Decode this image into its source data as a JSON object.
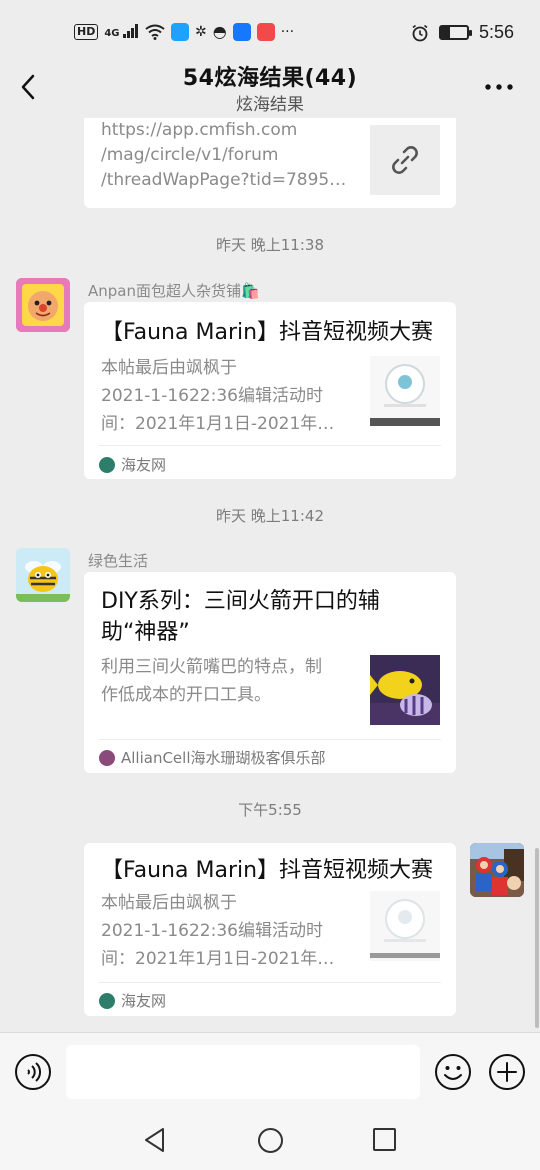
{
  "status_bar": {
    "hd": "HD",
    "signal": "4G",
    "time": "5:56",
    "battery_level": 0.35,
    "icons": [
      "hd-icon",
      "signal-icon",
      "wifi-icon",
      "app-icon",
      "weibo-icon",
      "qq-icon",
      "alipay-icon",
      "app-icon",
      "more-notifications-icon",
      "alarm-icon",
      "battery-icon"
    ]
  },
  "header": {
    "title": "54炫海结果(44)",
    "subtitle": "炫海结果",
    "back_icon": "chevron-left-icon",
    "more_icon": "more-horizontal-icon"
  },
  "messages": [
    {
      "type": "link-card-partial",
      "url_lines": [
        "https://app.cmfish.com",
        "/mag/circle/v1/forum",
        "/threadWapPage?tid=7895…"
      ],
      "thumb_icon": "link-icon"
    },
    {
      "timestamp": "昨天 晚上11:38",
      "sender": "Anpan面包超人杂货铺🛍️",
      "title": "【Fauna Marin】抖音短视频大赛",
      "desc_lines": [
        "本帖最后由飒枫于",
        "2021-1-1622:36编辑活动时",
        "间：2021年1月1日-2021年…"
      ],
      "source": "海友网"
    },
    {
      "timestamp": "昨天 晚上11:42",
      "sender": "绿色生活",
      "title_lines": [
        "DIY系列：三间火箭开口的辅",
        "助“神器”"
      ],
      "desc_lines": [
        "利用三间火箭嘴巴的特点，制",
        "作低成本的开口工具。"
      ],
      "source": "AllianCell海水珊瑚极客俱乐部"
    },
    {
      "timestamp": "下午5:55",
      "title": "【Fauna Marin】抖音短视频大赛",
      "desc_lines": [
        "本帖最后由飒枫于",
        "2021-1-1622:36编辑活动时",
        "间：2021年1月1日-2021年…"
      ],
      "source": "海友网"
    }
  ],
  "input_bar": {
    "placeholder": "",
    "voice_icon": "voice-icon",
    "emoji_icon": "emoji-icon",
    "plus_icon": "plus-icon"
  },
  "nav_bar": {
    "icons": [
      "nav-back-icon",
      "nav-home-icon",
      "nav-recent-icon"
    ]
  }
}
